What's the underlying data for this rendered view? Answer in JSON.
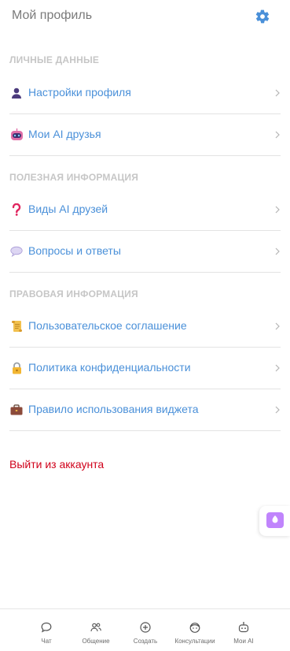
{
  "header": {
    "title": "Мой профиль",
    "gear_icon": "gear-icon",
    "accent": "#4a90d9"
  },
  "sections": [
    {
      "title": "ЛИЧНЫЕ ДАННЫЕ",
      "items": [
        {
          "label": "Настройки профиля",
          "icon": "user-silhouette-icon"
        },
        {
          "label": "Мои AI друзья",
          "icon": "robot-face-icon"
        }
      ]
    },
    {
      "title": "ПОЛЕЗНАЯ ИНФОРМАЦИЯ",
      "items": [
        {
          "label": "Виды AI друзей",
          "icon": "question-mark-icon"
        },
        {
          "label": "Вопросы и ответы",
          "icon": "speech-bubble-icon"
        }
      ]
    },
    {
      "title": "ПРАВОВАЯ ИНФОРМАЦИЯ",
      "items": [
        {
          "label": "Пользовательское соглашение",
          "icon": "scroll-icon"
        },
        {
          "label": "Политика конфиденциальности",
          "icon": "lock-icon"
        },
        {
          "label": "Правило использования виджета",
          "icon": "briefcase-icon"
        }
      ]
    }
  ],
  "logout": {
    "label": "Выйти из аккаунта",
    "color": "#d0021b"
  },
  "floating_button": {
    "icon": "chat-widget-icon"
  },
  "tabbar": [
    {
      "label": "Чат",
      "icon": "chat-bubble-icon"
    },
    {
      "label": "Общение",
      "icon": "people-icon"
    },
    {
      "label": "Создать",
      "icon": "plus-circle-icon"
    },
    {
      "label": "Консультации",
      "icon": "face-icon"
    },
    {
      "label": "Мои AI",
      "icon": "robot-icon"
    }
  ]
}
